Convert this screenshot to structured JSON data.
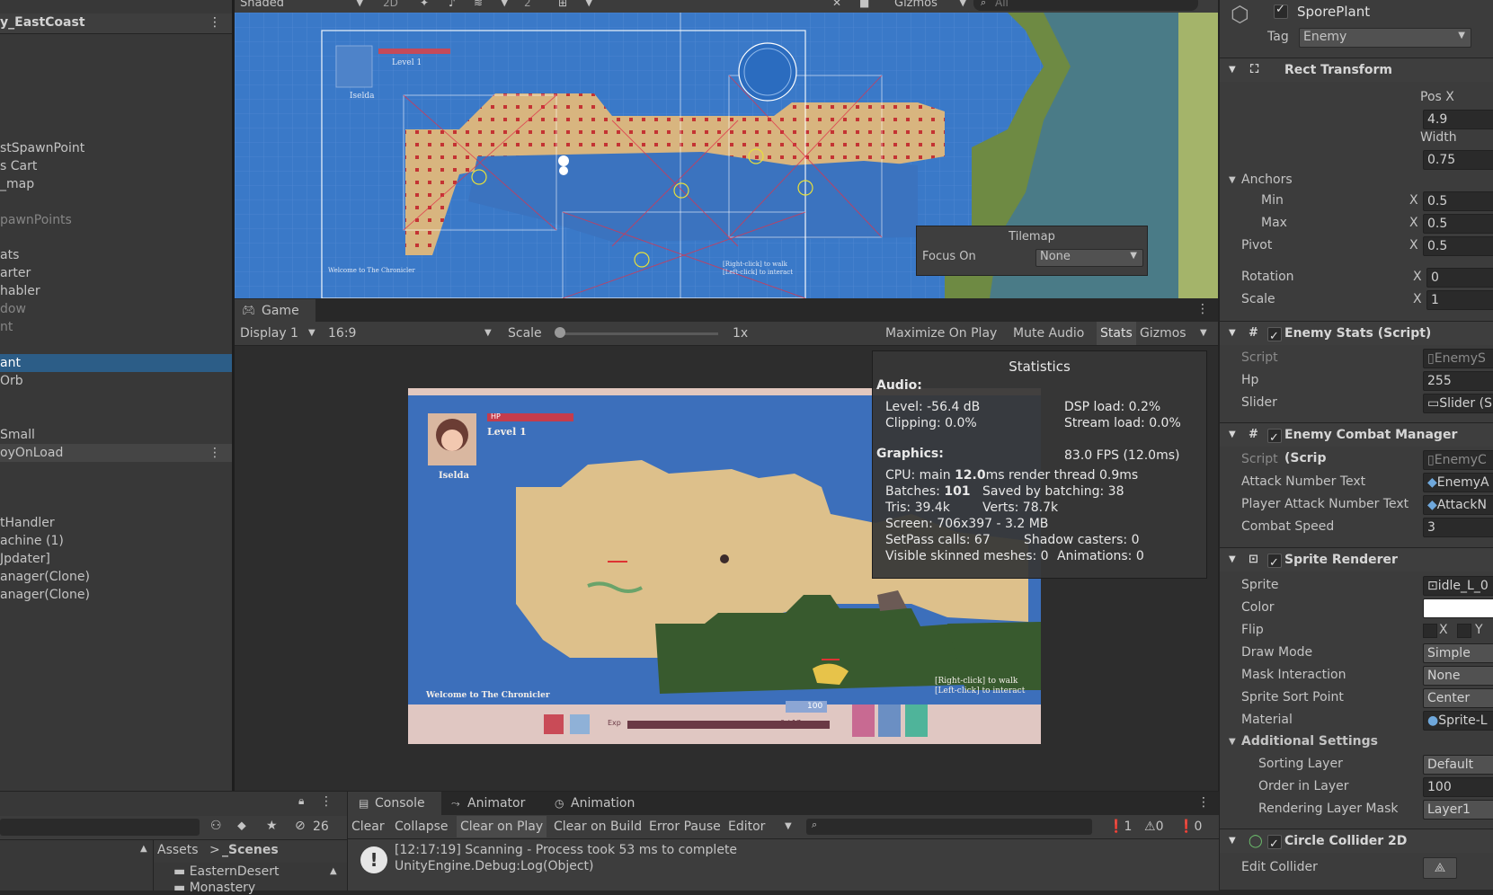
{
  "hierarchy": {
    "scene_name": "y_EastCoast",
    "items": [
      {
        "label": "stSpawnPoint",
        "state": "normal"
      },
      {
        "label": "s Cart",
        "state": "normal"
      },
      {
        "label": "_map",
        "state": "normal"
      },
      {
        "label": "pawnPoints",
        "state": "dim"
      },
      {
        "label": "ats",
        "state": "normal"
      },
      {
        "label": "arter",
        "state": "normal"
      },
      {
        "label": "habler",
        "state": "normal"
      },
      {
        "label": "dow",
        "state": "dim"
      },
      {
        "label": "nt",
        "state": "dim"
      },
      {
        "label": "ant",
        "state": "selected"
      },
      {
        "label": "Orb",
        "state": "normal"
      },
      {
        "label": "Small",
        "state": "normal"
      },
      {
        "label": "oyOnLoad",
        "state": "lite"
      },
      {
        "label": "tHandler",
        "state": "normal"
      },
      {
        "label": "achine (1)",
        "state": "normal"
      },
      {
        "label": "Jpdater]",
        "state": "normal"
      },
      {
        "label": "anager(Clone)",
        "state": "normal"
      },
      {
        "label": "anager(Clone)",
        "state": "normal"
      }
    ]
  },
  "scene_toolbar": {
    "shading": "Shaded",
    "mode_2d": "2D",
    "hidden_count": "2",
    "gizmos": "Gizmos",
    "search_placeholder": "All"
  },
  "tilemap_overlay": {
    "title": "Tilemap",
    "focus_label": "Focus On",
    "focus_value": "None"
  },
  "game_view": {
    "tab": "Game",
    "display": "Display 1",
    "aspect": "16:9",
    "scale_label": "Scale",
    "scale_value": "1x",
    "toggles": [
      "Maximize On Play",
      "Mute Audio",
      "Stats",
      "Gizmos"
    ]
  },
  "game_hud": {
    "player_name": "Iselda",
    "hp_label": "HP",
    "level": "Level 1",
    "welcome": "Welcome to The Chronicler",
    "hint_line1": "[Right-click] to walk",
    "hint_line2": "[Left-click] to interact",
    "exp_label": "Exp",
    "exp_value": "0 / 17",
    "mana_value": "100"
  },
  "statistics": {
    "title": "Statistics",
    "audio_header": "Audio:",
    "level": "Level: -56.4 dB",
    "clipping": "Clipping: 0.0%",
    "dsp_load": "DSP load: 0.2%",
    "stream_load": "Stream load: 0.0%",
    "graphics_header": "Graphics:",
    "fps": "83.0 FPS (12.0ms)",
    "cpu_prefix": "CPU: main ",
    "cpu_main": "12.0",
    "cpu_suffix": "ms  render thread 0.9ms",
    "batches_prefix": "Batches: ",
    "batches": "101",
    "saved_batching": "Saved by batching: 38",
    "tris": "Tris: 39.4k",
    "verts": "Verts: 78.7k",
    "screen": "Screen: 706x397 - 3.2 MB",
    "setpass": "SetPass calls: 67",
    "shadow_casters": "Shadow casters: 0",
    "skinned": "Visible skinned meshes: 0",
    "animations": "Animations: 0"
  },
  "inspector": {
    "object_name": "SporePlant",
    "tag_label": "Tag",
    "tag_value": "Enemy",
    "rect_transform": {
      "title": "Rect Transform",
      "pos_x_label": "Pos X",
      "pos_x": "4.9",
      "width_label": "Width",
      "width": "0.75",
      "anchors": "Anchors",
      "min": "Min",
      "min_x": "0.5",
      "max": "Max",
      "max_x": "0.5",
      "pivot": "Pivot",
      "pivot_x": "0.5",
      "rotation": "Rotation",
      "rotation_x": "0",
      "scale": "Scale",
      "scale_x": "1",
      "x_axis": "X"
    },
    "enemy_stats": {
      "title": "Enemy Stats (Script)",
      "script_label": "Script",
      "script_value": "EnemyS",
      "hp_label": "Hp",
      "hp_value": "255",
      "slider_label": "Slider",
      "slider_value": "Slider (S"
    },
    "enemy_combat": {
      "title": "Enemy Combat Manager (Scrip",
      "script_label": "Script",
      "script_value": "EnemyC",
      "attack_label": "Attack Number Text",
      "attack_value": "EnemyA",
      "player_attack_label": "Player Attack Number Text",
      "player_attack_value": "AttackN",
      "speed_label": "Combat Speed",
      "speed_value": "3"
    },
    "sprite_renderer": {
      "title": "Sprite Renderer",
      "sprite_label": "Sprite",
      "sprite_value": "idle_L_0",
      "color_label": "Color",
      "flip_label": "Flip",
      "flip_x": "X",
      "flip_y": "Y",
      "draw_mode_label": "Draw Mode",
      "draw_mode_value": "Simple",
      "mask_label": "Mask Interaction",
      "mask_value": "None",
      "sort_point_label": "Sprite Sort Point",
      "sort_point_value": "Center",
      "material_label": "Material",
      "material_value": "Sprite-L",
      "additional": "Additional Settings",
      "sorting_layer_label": "Sorting Layer",
      "sorting_layer_value": "Default",
      "order_label": "Order in Layer",
      "order_value": "100",
      "render_mask_label": "Rendering Layer Mask",
      "render_mask_value": "Layer1"
    },
    "circle_collider": {
      "title": "Circle Collider 2D",
      "edit_label": "Edit Collider"
    }
  },
  "project": {
    "hidden_count": "26",
    "breadcrumb_root": "Assets",
    "breadcrumb_sep": ">",
    "breadcrumb_current": "_Scenes",
    "folders": [
      "EasternDesert",
      "Monastery"
    ]
  },
  "console": {
    "tabs": [
      "Console",
      "Animator",
      "Animation"
    ],
    "buttons": [
      "Clear",
      "Collapse",
      "Clear on Play",
      "Clear on Build",
      "Error Pause",
      "Editor"
    ],
    "info_count": "1",
    "warn_count": "0",
    "error_count": "0",
    "log_line1": "[12:17:19] Scanning - Process took 53 ms to complete",
    "log_line2": "UnityEngine.Debug:Log(Object)"
  },
  "colors": {
    "selection": "#2c5d87",
    "panel": "#383838",
    "water": "#3a79c8",
    "sand": "#d8b57f",
    "grass": "#3f5a32"
  }
}
